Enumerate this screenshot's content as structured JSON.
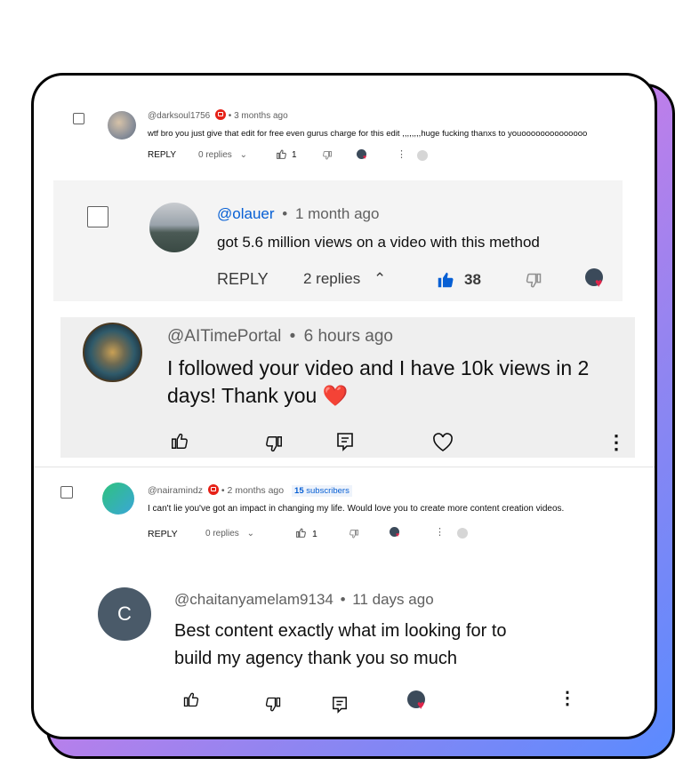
{
  "comments": [
    {
      "handle": "@darksoul1756",
      "time": "3 months ago",
      "text": "wtf bro you just give that edit for free even gurus charge for this edit ,,,,,,,,huge fucking thanxs to youoooooooooooooo",
      "reply_label": "REPLY",
      "replies": "0 replies",
      "likes": "1"
    },
    {
      "handle": "@olauer",
      "time": "1 month ago",
      "text": "got 5.6 million views on a video with this method",
      "reply_label": "REPLY",
      "replies": "2 replies",
      "likes": "38"
    },
    {
      "handle": "@AITimePortal",
      "time": "6 hours ago",
      "text": "I followed your video and I have 10k views in 2 days! Thank you",
      "heart": "❤️"
    },
    {
      "handle": "@nairamindz",
      "time": "2 months ago",
      "subs_count": "15",
      "subs_label": "subscribers",
      "text": "I can't lie you've got an impact in changing my life. Would love you to create more content creation videos.",
      "reply_label": "REPLY",
      "replies": "0 replies",
      "likes": "1"
    },
    {
      "handle": "@chaitanyamelam9134",
      "time": "11 days ago",
      "avatar_letter": "C",
      "text_line1": "Best content exactly what im looking for to",
      "text_line2": "build my agency thank you so much"
    }
  ],
  "separator": "•",
  "colors": {
    "accent_blue": "#065fd4",
    "heart_red": "#e0244a",
    "panel_gray": "#f1f1f1",
    "avatar_c": "#4a5a69",
    "gradient": [
      "#ff6cc4",
      "#8f85f1",
      "#5a8bff"
    ]
  },
  "icons": [
    "checkbox",
    "youtube-badge-icon",
    "thumbs-up-icon",
    "thumbs-down-icon",
    "chevron-down-icon",
    "chevron-up-icon",
    "creator-heart-icon",
    "more-vert-icon",
    "reply-icon",
    "heart-outline-icon"
  ]
}
